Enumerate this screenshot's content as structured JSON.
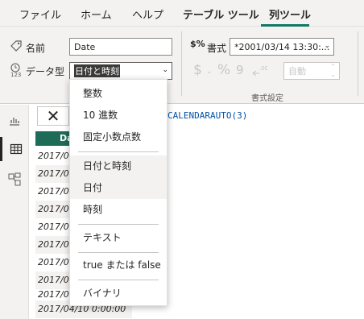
{
  "ribbon_tabs": [
    {
      "label": "ファイル"
    },
    {
      "label": "ホーム"
    },
    {
      "label": "ヘルプ"
    },
    {
      "label": "テーブル ツール"
    },
    {
      "label": "列ツール"
    }
  ],
  "active_tab_color": "#117865",
  "structure": {
    "name_label": "名前",
    "name_value": "Date",
    "datatype_label": "データ型",
    "datatype_value": "日付と時刻"
  },
  "formatting": {
    "format_label": "書式",
    "format_value": "*2001/03/14 13:30:...",
    "currency_symbol": "$",
    "percent_symbol": "%",
    "comma_symbol": "9",
    "decimals_value": "自動",
    "group_label": "書式設定"
  },
  "formula": {
    "cancel_glyph": "✕",
    "text": "CALENDARAUTO(3)"
  },
  "table": {
    "column_header": "Da",
    "rows": [
      "2017/04/",
      "2017/04/",
      "2017/04/",
      "2017/04/",
      "2017/04/",
      "2017/04/",
      "2017/04/",
      "2017/04/",
      "2017/04/",
      "2017/04/10 0:00:00"
    ]
  },
  "datatype_options": [
    {
      "label": "整数"
    },
    {
      "label": "10 進数"
    },
    {
      "label": "固定小数点数"
    },
    {
      "label": "日付と時刻",
      "selected": true
    },
    {
      "label": "日付",
      "hover": true
    },
    {
      "label": "時刻"
    },
    {
      "label": "テキスト"
    },
    {
      "label": "true または false"
    },
    {
      "label": "バイナリ"
    }
  ],
  "header_color": "#1e6b58"
}
